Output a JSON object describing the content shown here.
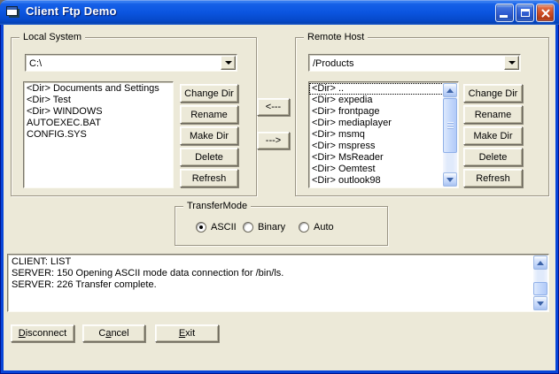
{
  "window": {
    "title": "Client Ftp Demo",
    "controls": {
      "minimize": "minimize",
      "maximize": "maximize",
      "close": "close"
    }
  },
  "colors": {
    "titlebar_blue": "#0B55E0",
    "window_border_blue": "#0845D8",
    "close_button_red": "#CC4A21",
    "form_background": "#ECE9D8",
    "list_background": "#FFFFFF",
    "scrollbar_blue": "#C4D8FB",
    "text": "#000000"
  },
  "local": {
    "group_label": "Local System",
    "path_value": "C:\\",
    "items": [
      "<Dir> Documents and Settings",
      "<Dir> Test",
      "<Dir> WINDOWS",
      "AUTOEXEC.BAT",
      "CONFIG.SYS"
    ]
  },
  "remote": {
    "group_label": "Remote Host",
    "path_value": "/Products",
    "items": [
      "<Dir> ..",
      "<Dir> expedia",
      "<Dir> frontpage",
      "<Dir> mediaplayer",
      "<Dir> msmq",
      "<Dir> mspress",
      "<Dir> MsReader",
      "<Dir> Oemtest",
      "<Dir> outlook98"
    ],
    "focused_item": "<Dir> .."
  },
  "file_buttons": [
    "Change Dir",
    "Rename",
    "Make Dir",
    "Delete",
    "Refresh"
  ],
  "transfer_arrows": {
    "to_local": "<---",
    "to_remote": "--->"
  },
  "transfer_mode": {
    "group_label": "TransferMode",
    "selected": "ASCII",
    "options": [
      {
        "label": "ASCII"
      },
      {
        "label": "Binary"
      },
      {
        "label": "Auto"
      }
    ]
  },
  "log": {
    "lines": [
      "CLIENT: LIST",
      "SERVER: 150 Opening ASCII mode data connection for /bin/ls.",
      "SERVER: 226 Transfer complete."
    ]
  },
  "footer": {
    "buttons": [
      {
        "pre": "",
        "key": "D",
        "rest": "isconnect"
      },
      {
        "pre": "C",
        "key": "a",
        "rest": "ncel"
      },
      {
        "pre": "",
        "key": "E",
        "rest": "xit"
      }
    ]
  }
}
